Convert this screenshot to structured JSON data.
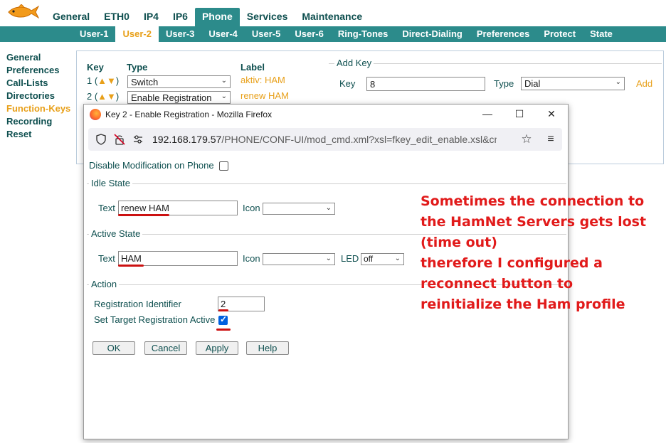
{
  "top_nav": {
    "tabs": [
      "General",
      "ETH0",
      "IP4",
      "IP6",
      "Phone",
      "Services",
      "Maintenance"
    ],
    "active": "Phone"
  },
  "sub_nav": {
    "tabs": [
      "User-1",
      "User-2",
      "User-3",
      "User-4",
      "User-5",
      "User-6",
      "Ring-Tones",
      "Direct-Dialing",
      "Preferences",
      "Protect",
      "State"
    ],
    "active": "User-2"
  },
  "sidebar": {
    "items": [
      "General",
      "Preferences",
      "Call-Lists",
      "Directories",
      "Function-Keys",
      "Recording",
      "Reset"
    ],
    "active": "Function-Keys"
  },
  "keys_table": {
    "headers": {
      "key": "Key",
      "type": "Type",
      "label": "Label"
    },
    "rows": [
      {
        "num": "1 (",
        "up": "▲",
        "down": "▼",
        "close": ")",
        "type": "Switch",
        "label": "aktiv: HAM"
      },
      {
        "num": "2 (",
        "up": "▲",
        "down": "▼",
        "close": ")",
        "type": "Enable Registration",
        "label": "renew HAM"
      }
    ]
  },
  "add_key": {
    "legend": "Add Key",
    "key_label": "Key",
    "key_value": "8",
    "type_label": "Type",
    "type_value": "Dial",
    "add_link": "Add"
  },
  "popup": {
    "title": "Key 2 - Enable Registration - Mozilla Firefox",
    "url_host": "192.168.179.57",
    "url_rest": "/PHONE/CONF-UI/mod_cmd.xml?xsl=fkey_edit_enable.xsl&cmd=fke",
    "disable_modification": {
      "label": "Disable Modification on Phone",
      "checked": false
    },
    "idle_state": {
      "legend": "Idle State",
      "text_label": "Text",
      "text_value": "renew HAM",
      "icon_label": "Icon",
      "icon_value": ""
    },
    "active_state": {
      "legend": "Active State",
      "text_label": "Text",
      "text_value": "HAM",
      "icon_label": "Icon",
      "icon_value": "",
      "led_label": "LED",
      "led_value": "off"
    },
    "action": {
      "legend": "Action",
      "reg_id_label": "Registration Identifier",
      "reg_id_value": "2",
      "set_target_label": "Set Target Registration Active",
      "set_target_checked": true
    },
    "buttons": {
      "ok": "OK",
      "cancel": "Cancel",
      "apply": "Apply",
      "help": "Help"
    }
  },
  "annotation": {
    "lines": [
      "Sometimes the connection to",
      "the HamNet Servers gets lost",
      "(time out)",
      "therefore I configured a",
      "reconnect button to",
      "reinitialize the Ham profile"
    ],
    "color": "#e11a1a"
  },
  "colors": {
    "teal": "#2c8b8b",
    "dark_teal": "#0e4f4f",
    "orange": "#e8a01a",
    "highlight_red": "#cc1111"
  }
}
